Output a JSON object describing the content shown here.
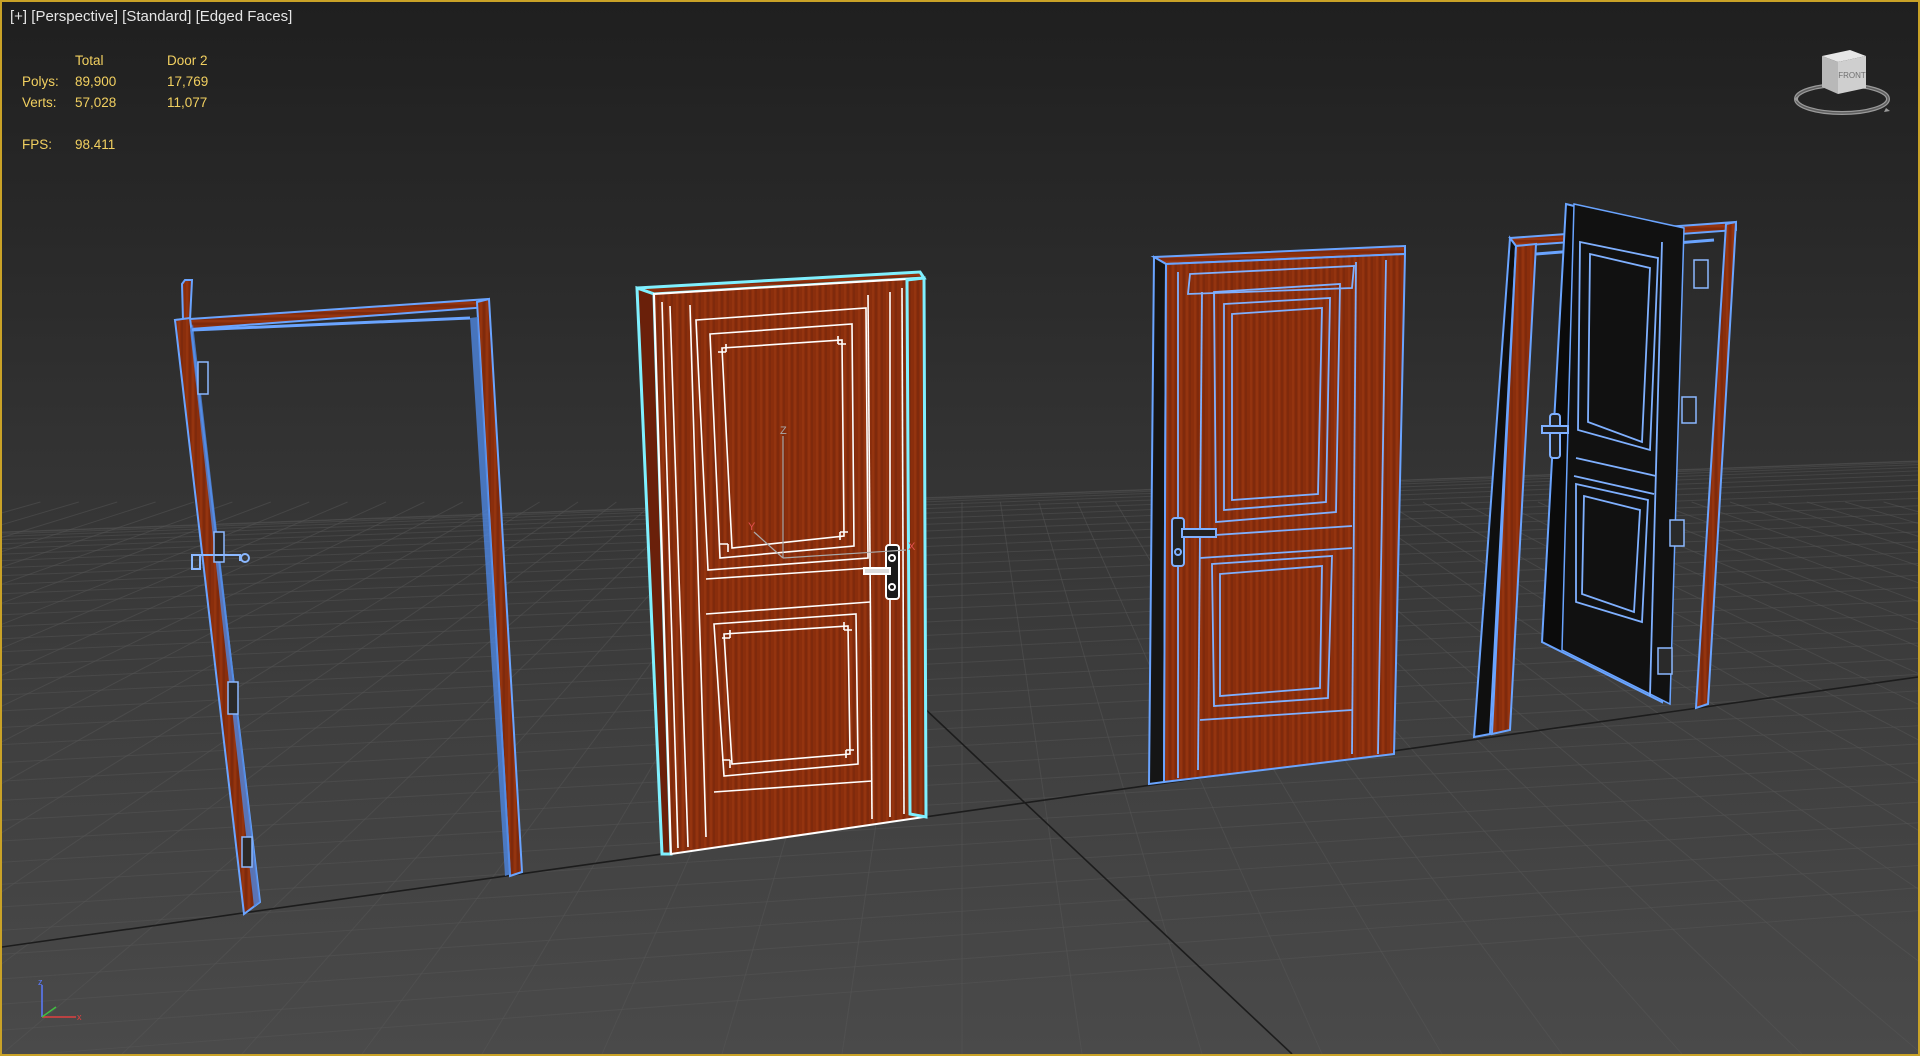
{
  "viewport": {
    "label_parts": [
      "[+]",
      "[Perspective]",
      "[Standard]",
      "[Edged Faces]"
    ]
  },
  "stats": {
    "header": [
      "",
      "Total",
      "Door 2"
    ],
    "rows": [
      {
        "label": "Polys:",
        "total": "89,900",
        "selected": "17,769"
      },
      {
        "label": "Verts:",
        "total": "57,028",
        "selected": "11,077"
      }
    ],
    "fps_label": "FPS:",
    "fps_value": "98.411"
  },
  "viewcube": {
    "face_label": "FRONT",
    "icon": "viewcube-icon"
  },
  "gizmo_axes": [
    "X",
    "Y",
    "Z"
  ],
  "objects": [
    {
      "name": "door-frame-1",
      "kind": "empty door frame with hinges"
    },
    {
      "name": "door-2",
      "kind": "closed panel door (selected)"
    },
    {
      "name": "door-3",
      "kind": "closed panel door with lever handle"
    },
    {
      "name": "door-4",
      "kind": "open panel door"
    }
  ],
  "colors": {
    "viewport_border": "#c9a227",
    "stats_text": "#f2d060",
    "edge_blue": "#6aa4ff",
    "selection_cyan": "#7ff0ff",
    "wood": "#8a2e0c",
    "wood_dark": "#6a200a",
    "grid_line": "#585858"
  }
}
